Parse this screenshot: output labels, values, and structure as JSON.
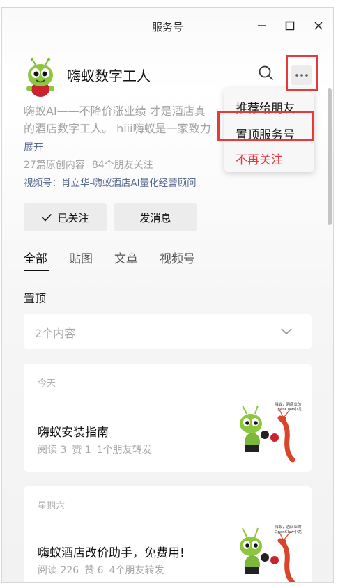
{
  "window": {
    "title": "服务号"
  },
  "account": {
    "name": "嗨蚁数字工人",
    "description_line1": "嗨蚁AI——不降价涨业绩 才是酒店真",
    "description_line2": "的酒店数字工人。 hiii嗨蚁是一家致力",
    "expand_label": "展开",
    "original_count": "27篇原创内容",
    "friends_following": "84个朋友关注",
    "channel": "视频号：肖立华-嗨蚁酒店AI量化经营顾问"
  },
  "actions": {
    "followed_label": "已关注",
    "message_label": "发消息"
  },
  "tabs": [
    "全部",
    "贴图",
    "文章",
    "视频号"
  ],
  "pinned": {
    "label": "置顶",
    "count": "2个内容"
  },
  "articles": [
    {
      "date": "今天",
      "title": "嗨蚁安装指南",
      "reads": "阅读 3",
      "likes": "赞 1",
      "shares": "1个朋友转发",
      "thumb_text_1": "嗨蚁，酒店业的",
      "thumb_text_2": "OpenClaw小龙虾"
    },
    {
      "date": "星期六",
      "title": "嗨蚁酒店改价助手，免费用!",
      "reads": "阅读 226",
      "likes": "赞 6",
      "shares": "4个朋友转发",
      "thumb_text_1": "嗨蚁，酒店业的",
      "thumb_text_2": "OpenClaw小龙虾"
    }
  ],
  "menu": {
    "recommend": "推荐给朋友",
    "pin": "置顶服务号",
    "unfollow": "不再关注"
  },
  "colors": {
    "accent_red": "#e5393c",
    "link_blue": "#56698e"
  },
  "icons": [
    "minimize-icon",
    "maximize-icon",
    "close-icon",
    "search-icon",
    "more-icon",
    "check-icon",
    "chevron-down-icon"
  ]
}
